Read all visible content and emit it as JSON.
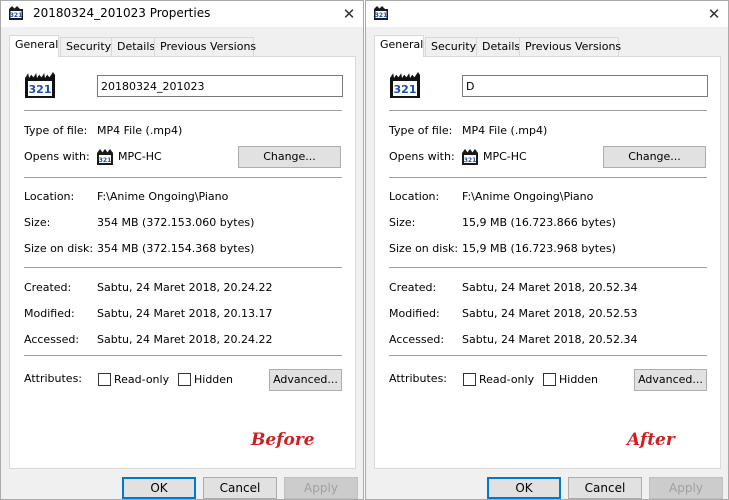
{
  "dialogs": [
    {
      "title": "20180324_201023 Properties",
      "tabs": [
        "General",
        "Security",
        "Details",
        "Previous Versions"
      ],
      "file_name": "20180324_201023",
      "type_label": "Type of file:",
      "type_value": "MP4 File (.mp4)",
      "opens_label": "Opens with:",
      "opens_value": "MPC-HC",
      "change_button": "Change...",
      "location_label": "Location:",
      "location_value": "F:\\Anime Ongoing\\Piano",
      "size_label": "Size:",
      "size_value": "354 MB (372.153.060 bytes)",
      "size_on_disk_label": "Size on disk:",
      "size_on_disk_value": "354 MB (372.154.368 bytes)",
      "created_label": "Created:",
      "created_value": "Sabtu, 24 Maret 2018, 20.24.22",
      "modified_label": "Modified:",
      "modified_value": "Sabtu, 24 Maret 2018, 20.13.17",
      "accessed_label": "Accessed:",
      "accessed_value": "Sabtu, 24 Maret 2018, 20.24.22",
      "attributes_label": "Attributes:",
      "readonly_label": "Read-only",
      "hidden_label": "Hidden",
      "advanced_button": "Advanced...",
      "caption": "Before",
      "ok_button": "OK",
      "cancel_button": "Cancel",
      "apply_button": "Apply"
    },
    {
      "title": "",
      "tabs": [
        "General",
        "Security",
        "Details",
        "Previous Versions"
      ],
      "file_name": "D",
      "type_label": "Type of file:",
      "type_value": "MP4 File (.mp4)",
      "opens_label": "Opens with:",
      "opens_value": "MPC-HC",
      "change_button": "Change...",
      "location_label": "Location:",
      "location_value": "F:\\Anime Ongoing\\Piano",
      "size_label": "Size:",
      "size_value": "15,9 MB (16.723.866 bytes)",
      "size_on_disk_label": "Size on disk:",
      "size_on_disk_value": "15,9 MB (16.723.968 bytes)",
      "created_label": "Created:",
      "created_value": "Sabtu, 24 Maret 2018, 20.52.34",
      "modified_label": "Modified:",
      "modified_value": "Sabtu, 24 Maret 2018, 20.52.53",
      "accessed_label": "Accessed:",
      "accessed_value": "Sabtu, 24 Maret 2018, 20.52.34",
      "attributes_label": "Attributes:",
      "readonly_label": "Read-only",
      "hidden_label": "Hidden",
      "advanced_button": "Advanced...",
      "caption": "After",
      "ok_button": "OK",
      "cancel_button": "Cancel",
      "apply_button": "Apply"
    }
  ],
  "colors": {
    "caption": "#d11f1f",
    "ok_border": "#0078d7",
    "dialog_bg": "#f0f0f0"
  },
  "icons": [
    "mpc-hc-app-icon",
    "close-icon"
  ]
}
